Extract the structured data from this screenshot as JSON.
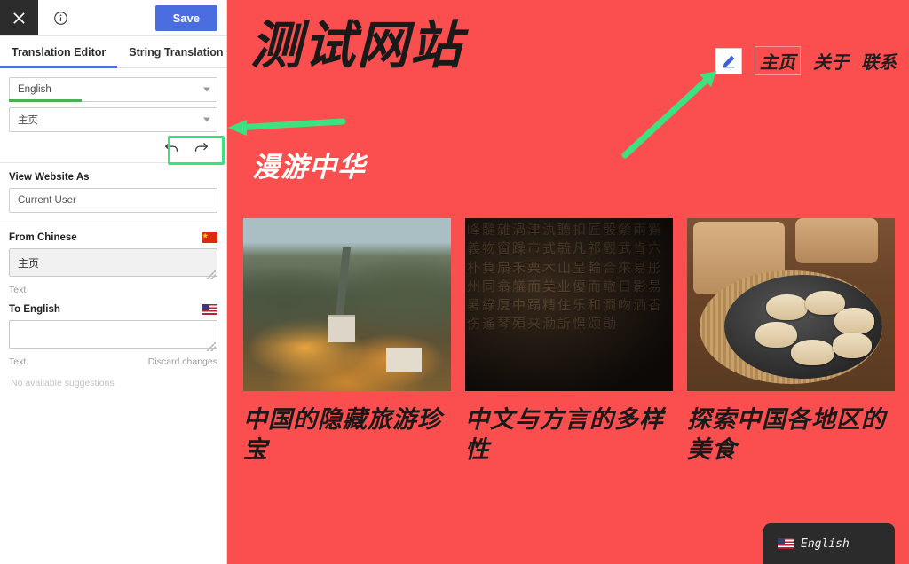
{
  "sidebar": {
    "topbar": {
      "close_icon": "close-icon",
      "info_icon": "info-circle-icon",
      "save_label": "Save"
    },
    "tabs": [
      {
        "label": "Translation Editor",
        "active": true
      },
      {
        "label": "String Translation",
        "active": false
      }
    ],
    "language_select": {
      "value": "English",
      "caret": "chevron-down-icon"
    },
    "page_select": {
      "value": "主页",
      "caret": "chevron-down-icon"
    },
    "history": {
      "undo_icon": "undo-arrow-icon",
      "redo_icon": "redo-arrow-icon"
    },
    "view_website_as": {
      "label": "View Website As",
      "value": "Current User",
      "caret": "chevron-down-icon"
    },
    "source": {
      "label": "From Chinese",
      "flag": "flag-china-icon",
      "value": "主页",
      "hint": "Text"
    },
    "target": {
      "label": "To English",
      "flag": "flag-usa-icon",
      "value": "",
      "placeholder": "",
      "hint": "Text",
      "discard_label": "Discard changes"
    },
    "suggestions": "No available suggestions"
  },
  "preview": {
    "background_color": "#fb4e4e",
    "site_title": "测试网站",
    "site_subtitle": "漫游中华",
    "edit_button_icon": "pencil-edit-icon",
    "nav": [
      {
        "label": "主页",
        "active": true
      },
      {
        "label": "关于",
        "active": false
      },
      {
        "label": "联系",
        "active": false
      }
    ],
    "cards": [
      {
        "image": "great-wall-autumn-photo",
        "caption": "中国的隐藏旅游珍宝"
      },
      {
        "image": "ancient-chinese-stone-inscription-photo",
        "caption": "中文与方言的多样性"
      },
      {
        "image": "steamed-dumplings-plate-photo",
        "caption": "探索中国各地区的美食"
      }
    ],
    "stone_glyphs": "峰髓雜渦津汍聽扣匠骰縈兩獬義物窗躁市式毓凡祁觀武肯穴朴負扇禾栗木山呈輪合來易彤州同翕艤而美业優而轍日影昜暑綠厦中蹋精住乐和澗吻洒香伤遙琴殞来泐訢憬颂勛",
    "language_switcher": {
      "flag": "flag-usa-icon",
      "label": "English"
    }
  },
  "annotations": {
    "arrow_to_page_select": "green-arrow-left",
    "arrow_to_edit_button": "green-arrow-diagonal",
    "highlight_undo_redo": "green-highlight-box",
    "color": "#3ee17f"
  }
}
